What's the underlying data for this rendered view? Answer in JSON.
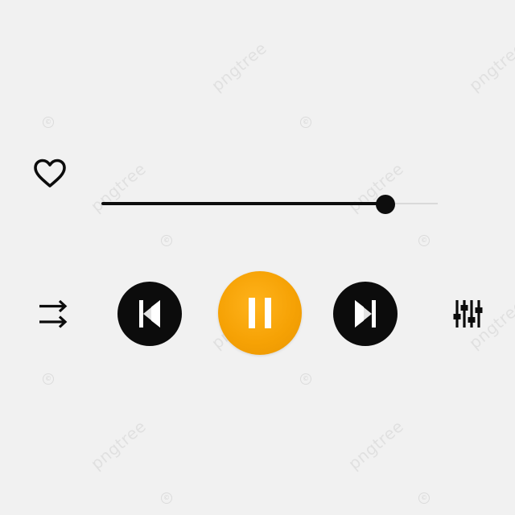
{
  "player": {
    "progress_fraction": 0.844,
    "is_playing": true,
    "liked": false
  },
  "icons": {
    "like": "heart-outline-icon",
    "repeat": "repeat-arrows-icon",
    "previous": "skip-previous-icon",
    "play_pause": "pause-icon",
    "next": "skip-next-icon",
    "equalizer": "equalizer-sliders-icon"
  },
  "colors": {
    "background": "#f1f1f1",
    "accent": "#f6a205",
    "dark": "#0c0c0c",
    "track_remaining": "#d9d9d9",
    "icon_white": "#ffffff"
  },
  "watermark": {
    "text": "pngtree",
    "mark": "©"
  }
}
